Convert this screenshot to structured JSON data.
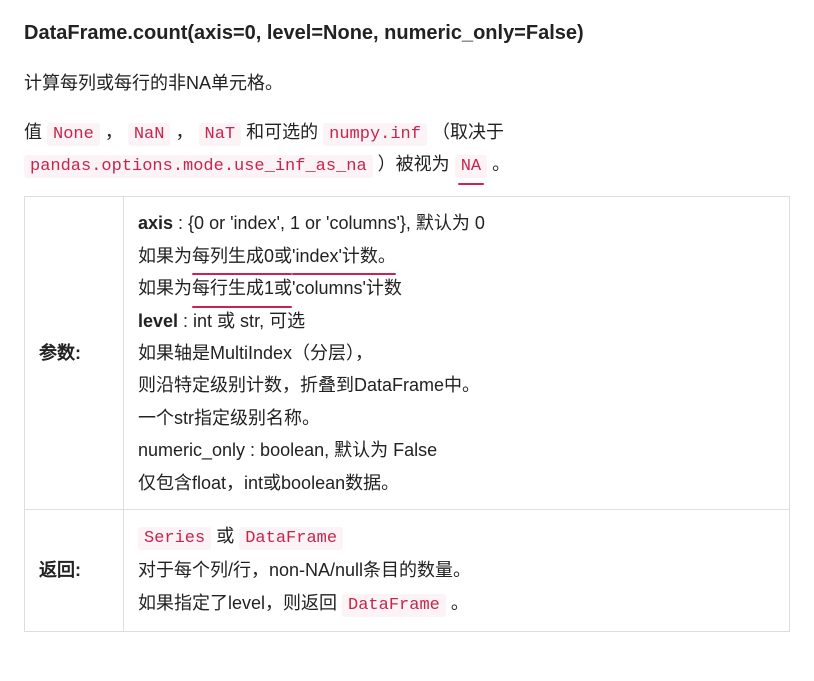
{
  "signature": "DataFrame.count(axis=0, level=None, numeric_only=False)",
  "summary": "计算每列或每行的非NA单元格。",
  "na_sentence": {
    "prefix": "值 ",
    "none": "None",
    "sep1": " ，",
    "nan": "NaN",
    "sep2": " ，",
    "nat": "NaT",
    "mid1": " 和可选的 ",
    "numpyinf": "numpy.inf",
    "mid2": " （取决于 ",
    "opt": "pandas.options.mode.use_inf_as_na",
    "mid3": " ）被视为 ",
    "na": "NA",
    "tail": " 。"
  },
  "params_header": "参数:",
  "returns_header": "返回:",
  "params": {
    "axis_label": "axis",
    "axis_type": " : {0 or 'index', 1 or 'columns'}, 默认为 0",
    "axis_l2a": "如果为",
    "axis_l2b": "每列生成0或",
    "axis_l2c": "'index'计数。",
    "axis_l3a": "如果为",
    "axis_l3b": "每行生成1或",
    "axis_l3c": "'columns'计数",
    "level_label": "level",
    "level_type": " : int 或 str, 可选",
    "level_l2": "如果轴是MultiIndex（分层），",
    "level_l3": "则沿特定级别计数，折叠到DataFrame中。",
    "level_l4": "一个str指定级别名称。",
    "numonly_l1": "numeric_only : boolean, 默认为 False",
    "numonly_l2": "仅包含float，int或boolean数据。"
  },
  "returns": {
    "series": "Series",
    "or": " 或 ",
    "dataframe": "DataFrame",
    "l2": "对于每个列/行，non-NA/null条目的数量。",
    "l3a": "如果指定了level，则返回 ",
    "l3b": "DataFrame",
    "l3c": " 。"
  }
}
